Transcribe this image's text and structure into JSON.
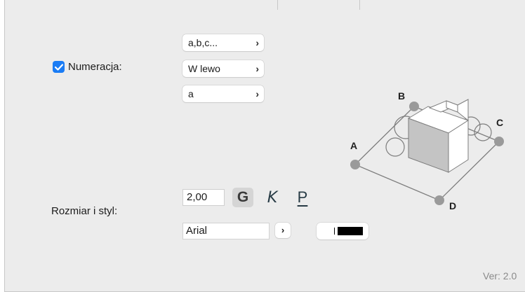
{
  "numbering": {
    "checkbox_label": "Numeracja:",
    "checked": true,
    "popups": [
      "a,b,c...",
      "W lewo",
      "a"
    ]
  },
  "size_style": {
    "label": "Rozmiar i styl:",
    "size_value": "2,00",
    "bold_label": "G",
    "italic_label": "K",
    "underline_label": "P",
    "font_value": "Arial",
    "font_popup_chevron": "›",
    "color": "#000000"
  },
  "diagram": {
    "corner_labels": [
      "A",
      "B",
      "C",
      "D"
    ]
  },
  "footer": {
    "version": "Ver: 2.0"
  },
  "icons": {
    "popup_chevron": "›",
    "checkmark": "✓"
  },
  "colors": {
    "accent": "#1a7cf5",
    "panel_bg": "#ececec"
  }
}
